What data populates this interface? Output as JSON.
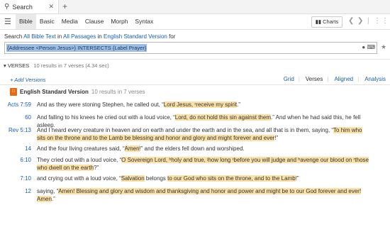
{
  "tab": {
    "title": "Search"
  },
  "menu": {
    "tabs": [
      "Bible",
      "Basic",
      "Media",
      "Clause",
      "Morph",
      "Syntax"
    ],
    "charts_label": "Charts"
  },
  "search": {
    "prefix": "Search",
    "scope1": "All Bible Text",
    "in_word": "in",
    "scope2": "All Passages",
    "in_word2": "in",
    "version": "English Standard Version",
    "for_word": "for",
    "query": "{Addressee <Person Jesus>} INTERSECTS {Label Prayer}"
  },
  "verses": {
    "heading": "VERSES",
    "count": "10 results in 7 verses (4.34 sec)",
    "add_versions": "Add Versions",
    "views": [
      "Grid",
      "Verses",
      "Aligned",
      "Analysis"
    ],
    "book_title": "English Standard Version",
    "book_sub": "10 results in 7 verses"
  },
  "rows": [
    {
      "ref": "Acts 7:59",
      "parts": [
        [
          "And as they were stoning Stephen, he called out, “",
          false
        ],
        [
          "Lord Jesus, ʳreceive my spirit",
          true
        ],
        [
          ".”",
          false
        ]
      ]
    },
    {
      "ref": "60",
      "parts": [
        [
          "And falling to his knees he cried out with a loud voice, “",
          false
        ],
        [
          "Lord, do not hold this sin against them",
          true
        ],
        [
          ".” And when he had said this, he fell asleep.",
          false
        ]
      ]
    },
    {
      "ref": "Rev 5:13",
      "parts": [
        [
          "And I heard every creature in heaven and on earth and under the earth and in the sea, and all that is in them, saying, “",
          false
        ],
        [
          "To him who sits on the throne and to the Lamb be blessing and honor and glory and might forever and ever",
          true
        ],
        [
          "!”",
          false
        ]
      ]
    },
    {
      "ref": "14",
      "parts": [
        [
          "And the four living creatures said, “",
          false
        ],
        [
          "Amen",
          true
        ],
        [
          "!” and the elders fell down and worshiped.",
          false
        ]
      ]
    },
    {
      "ref": "6:10",
      "parts": [
        [
          "They cried out with a loud voice, “",
          false
        ],
        [
          "O Sovereign Lord, ʰholy and true, ʲhow long ʳbefore you will judge and ʰavenge our blood on ʳthose who dwell on the earth",
          true
        ],
        [
          "?”",
          false
        ]
      ]
    },
    {
      "ref": "7:10",
      "parts": [
        [
          "and crying out with a loud voice, “",
          false
        ],
        [
          "Salvation",
          true
        ],
        [
          " belongs ",
          false
        ],
        [
          "to our God who sits on the throne, and to the Lamb",
          true
        ],
        [
          "!”",
          false
        ]
      ]
    },
    {
      "ref": "12",
      "parts": [
        [
          "saying, “",
          false
        ],
        [
          "Amen! Blessing and glory and wisdom and thanksgiving and honor and power and might be ",
          true
        ],
        [
          "to our God forever and ever! Amen",
          true
        ],
        [
          ".”",
          false
        ]
      ]
    }
  ]
}
